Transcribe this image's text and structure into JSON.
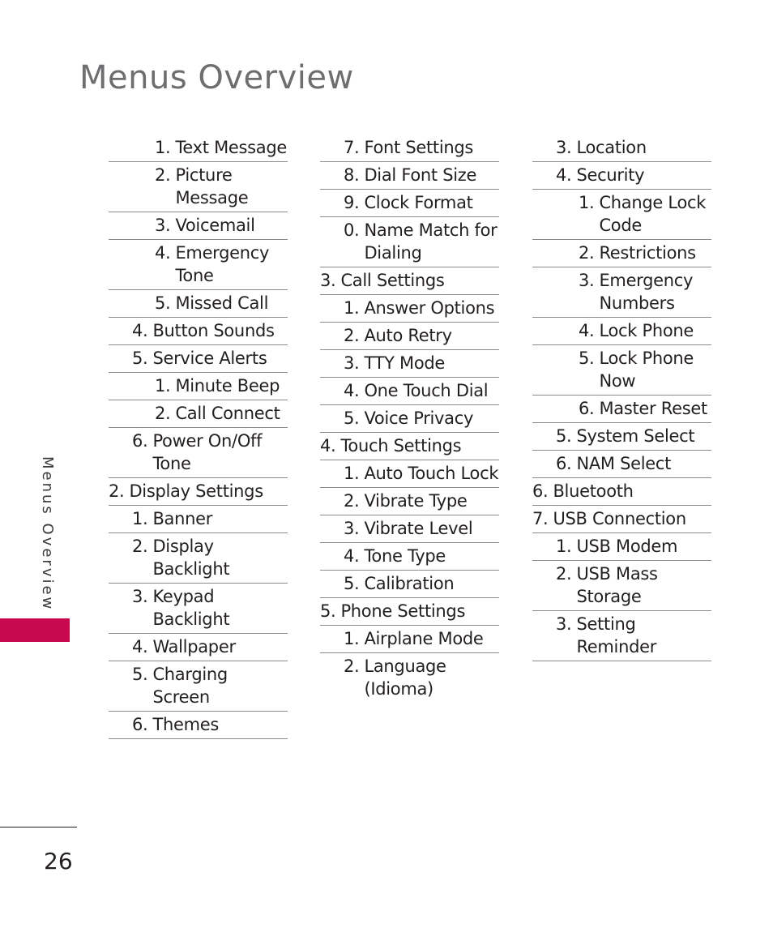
{
  "page_title": "Menus Overview",
  "side_label": "Menus Overview",
  "page_number": "26",
  "accent_color": "#c8084f",
  "columns": [
    [
      {
        "num": "1.",
        "text": "Text Message",
        "level": 2
      },
      {
        "num": "2.",
        "text": "Picture Message",
        "level": 2
      },
      {
        "num": "3.",
        "text": "Voicemail",
        "level": 2
      },
      {
        "num": "4.",
        "text": "Emergency Tone",
        "level": 2
      },
      {
        "num": "5.",
        "text": "Missed Call",
        "level": 2
      },
      {
        "num": "4.",
        "text": "Button Sounds",
        "level": 1
      },
      {
        "num": "5.",
        "text": "Service Alerts",
        "level": 1
      },
      {
        "num": "1.",
        "text": "Minute Beep",
        "level": 2
      },
      {
        "num": "2.",
        "text": "Call Connect",
        "level": 2
      },
      {
        "num": "6.",
        "text": "Power On/Off Tone",
        "level": 1
      },
      {
        "num": "2.",
        "text": "Display Settings",
        "level": 0
      },
      {
        "num": "1.",
        "text": "Banner",
        "level": 1
      },
      {
        "num": "2.",
        "text": "Display Backlight",
        "level": 1
      },
      {
        "num": "3.",
        "text": "Keypad Backlight",
        "level": 1
      },
      {
        "num": "4.",
        "text": "Wallpaper",
        "level": 1
      },
      {
        "num": "5.",
        "text": "Charging Screen",
        "level": 1
      },
      {
        "num": "6.",
        "text": "Themes",
        "level": 1
      }
    ],
    [
      {
        "num": "7.",
        "text": "Font Settings",
        "level": 1
      },
      {
        "num": "8.",
        "text": "Dial Font Size",
        "level": 1
      },
      {
        "num": "9.",
        "text": "Clock Format",
        "level": 1
      },
      {
        "num": "0.",
        "text": "Name Match for Dialing",
        "level": 1
      },
      {
        "num": "3.",
        "text": "Call Settings",
        "level": 0
      },
      {
        "num": "1.",
        "text": "Answer Options",
        "level": 1
      },
      {
        "num": "2.",
        "text": "Auto Retry",
        "level": 1
      },
      {
        "num": "3.",
        "text": "TTY Mode",
        "level": 1
      },
      {
        "num": "4.",
        "text": "One Touch Dial",
        "level": 1
      },
      {
        "num": "5.",
        "text": "Voice Privacy",
        "level": 1
      },
      {
        "num": "4.",
        "text": "Touch Settings",
        "level": 0
      },
      {
        "num": "1.",
        "text": "Auto Touch Lock",
        "level": 1
      },
      {
        "num": "2.",
        "text": "Vibrate Type",
        "level": 1
      },
      {
        "num": "3.",
        "text": "Vibrate Level",
        "level": 1
      },
      {
        "num": "4.",
        "text": "Tone Type",
        "level": 1
      },
      {
        "num": "5.",
        "text": "Calibration",
        "level": 1
      },
      {
        "num": "5.",
        "text": "Phone Settings",
        "level": 0
      },
      {
        "num": "1.",
        "text": "Airplane Mode",
        "level": 1
      },
      {
        "num": "2.",
        "text": "Language (Idioma)",
        "level": 1
      }
    ],
    [
      {
        "num": "3.",
        "text": "Location",
        "level": 1
      },
      {
        "num": "4.",
        "text": "Security",
        "level": 1
      },
      {
        "num": "1.",
        "text": "Change Lock Code",
        "level": 2
      },
      {
        "num": "2.",
        "text": "Restrictions",
        "level": 2
      },
      {
        "num": "3.",
        "text": "Emergency Numbers",
        "level": 2
      },
      {
        "num": "4.",
        "text": "Lock Phone",
        "level": 2
      },
      {
        "num": "5.",
        "text": "Lock Phone Now",
        "level": 2
      },
      {
        "num": "6.",
        "text": "Master Reset",
        "level": 2
      },
      {
        "num": "5.",
        "text": "System Select",
        "level": 1
      },
      {
        "num": "6.",
        "text": "NAM Select",
        "level": 1
      },
      {
        "num": "6.",
        "text": "Bluetooth",
        "level": 0
      },
      {
        "num": "7.",
        "text": "USB Connection",
        "level": 0
      },
      {
        "num": "1.",
        "text": "USB Modem",
        "level": 1
      },
      {
        "num": "2.",
        "text": "USB Mass Storage",
        "level": 1
      },
      {
        "num": "3.",
        "text": "Setting Reminder",
        "level": 1
      }
    ]
  ]
}
